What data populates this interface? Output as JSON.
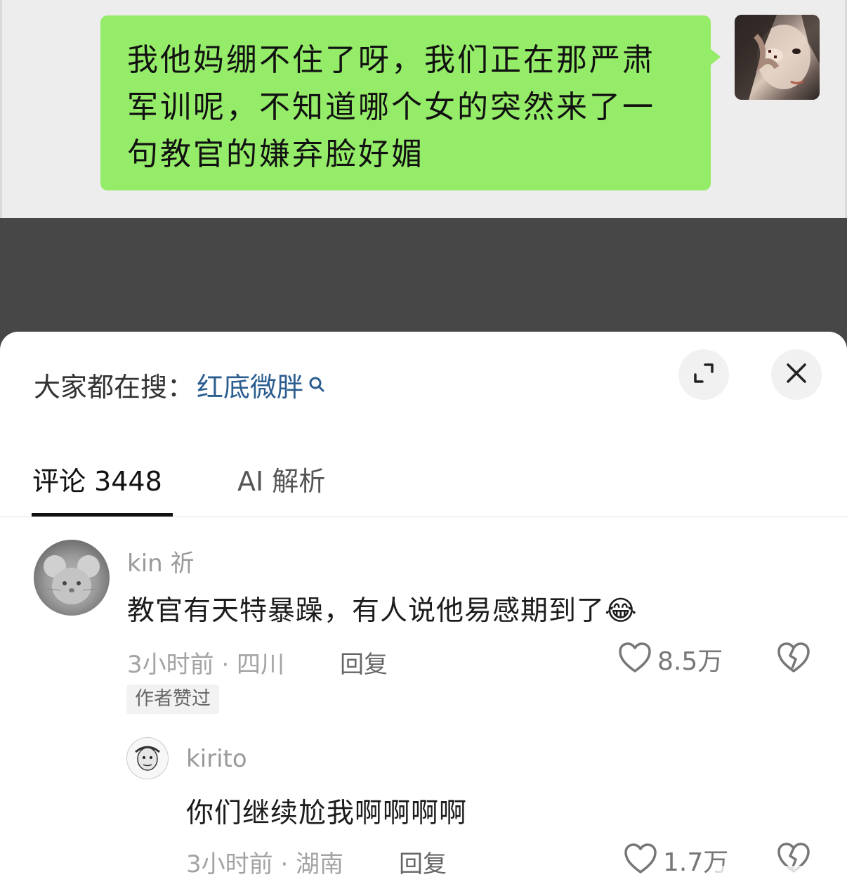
{
  "chat": {
    "message": "我他妈绷不住了呀，我们正在那严肃军训呢，不知道哪个女的突然来了一句教官的嫌弃脸好媚",
    "bubble_color": "#95ec69"
  },
  "panel": {
    "search_prefix": "大家都在搜：",
    "search_term": "红底微胖",
    "search_term_color": "#2b5d8f",
    "expand_icon": "expand-icon",
    "close_icon": "close-icon"
  },
  "tabs": [
    {
      "label": "评论 3448",
      "active": true
    },
    {
      "label": "AI 解析",
      "active": false
    }
  ],
  "comments": [
    {
      "username": "kin 祈",
      "text": "教官有天特暴躁，有人说他易感期到了",
      "emoji": "😂",
      "time_location": "3小时前 · 四川",
      "reply_label": "回复",
      "likes": "8.5万",
      "badge": "作者赞过",
      "replies": [
        {
          "username": "kirito",
          "text": "你们继续尬我啊啊啊啊",
          "time_location": "3小时前 · 湖南",
          "reply_label": "回复",
          "likes": "1.7万"
        }
      ]
    }
  ]
}
